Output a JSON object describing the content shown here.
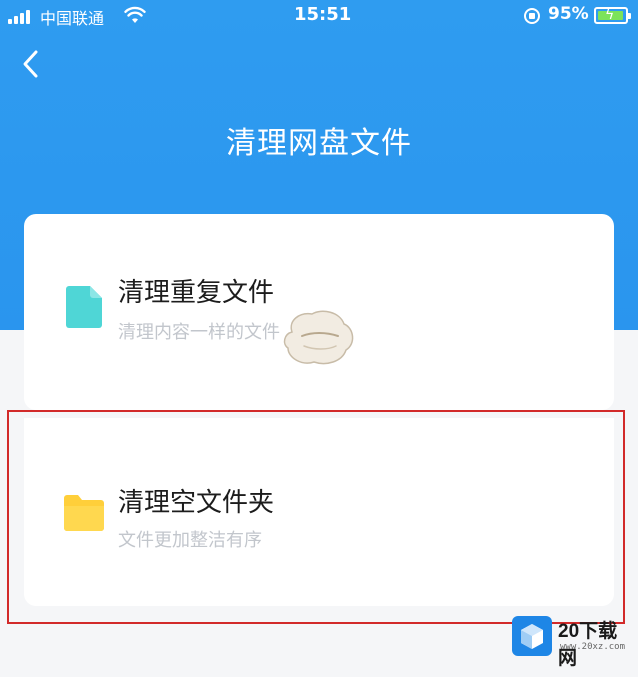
{
  "status_bar": {
    "carrier": "中国联通",
    "time": "15:51",
    "battery_percent": "95%",
    "battery_level": 0.95,
    "icons": [
      "signal-icon",
      "wifi-icon",
      "rotation-lock-icon",
      "battery-icon"
    ]
  },
  "header": {
    "back_icon": "chevron-left-icon",
    "title": "清理网盘文件"
  },
  "options": [
    {
      "title": "清理重复文件",
      "subtitle": "清理内容一样的文件",
      "icon": "document-icon",
      "icon_color": "#4fd6d6"
    },
    {
      "title": "清理空文件夹",
      "subtitle": "文件更加整洁有序",
      "icon": "folder-icon",
      "icon_color": "#ffcf3a"
    }
  ],
  "watermark": {
    "text": "20下载网",
    "sub": "www.20xz.com"
  },
  "colors": {
    "header_blue": "#2f9cf0",
    "highlight_red": "#d22a2a",
    "title_text": "#1c1c1c",
    "subtitle_text": "#c2c6cc"
  }
}
